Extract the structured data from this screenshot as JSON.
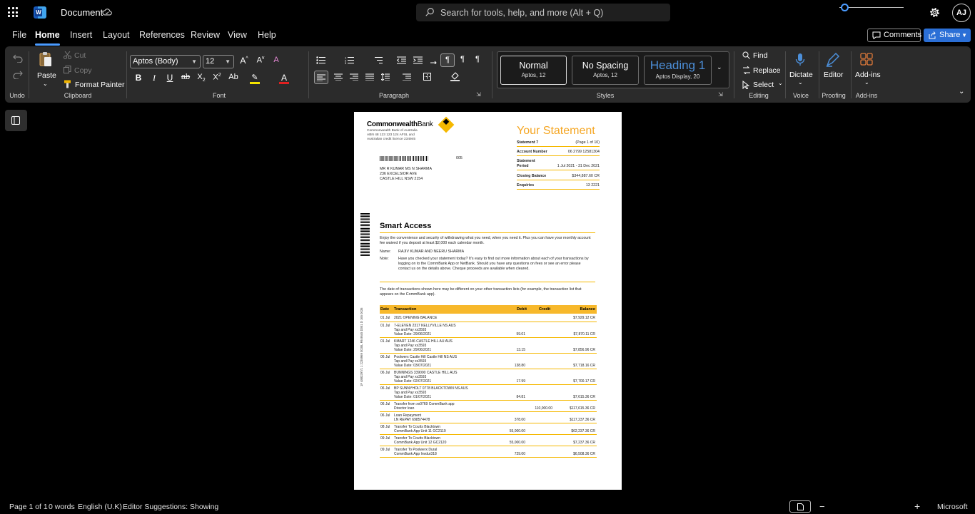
{
  "titlebar": {
    "app_icon": "word-icon",
    "app_letter": "W",
    "document_title": "Document",
    "search_placeholder": "Search for tools, help, and more (Alt + Q)",
    "avatar_initials": "AJ"
  },
  "menu": {
    "tabs": [
      "File",
      "Home",
      "Insert",
      "Layout",
      "References",
      "Review",
      "View",
      "Help"
    ],
    "active_tab": "Home",
    "comments_label": "Comments",
    "share_label": "Share"
  },
  "ribbon": {
    "undo": {
      "group_label": "Undo"
    },
    "clipboard": {
      "group_label": "Clipboard",
      "paste": "Paste",
      "cut": "Cut",
      "copy": "Copy",
      "format_painter": "Format Painter"
    },
    "font": {
      "group_label": "Font",
      "font_name": "Aptos (Body)",
      "font_size": "12"
    },
    "paragraph": {
      "group_label": "Paragraph"
    },
    "styles": {
      "group_label": "Styles",
      "items": [
        {
          "name": "Normal",
          "sub": "Aptos, 12"
        },
        {
          "name": "No Spacing",
          "sub": "Aptos, 12"
        },
        {
          "name": "Heading 1",
          "sub": "Aptos Display, 20"
        }
      ]
    },
    "editing": {
      "group_label": "Editing",
      "find": "Find",
      "replace": "Replace",
      "select": "Select"
    },
    "voice": {
      "group_label": "Voice",
      "dictate": "Dictate"
    },
    "proofing": {
      "group_label": "Proofing",
      "editor": "Editor"
    },
    "addins": {
      "group_label": "Add-ins",
      "addins": "Add-ins"
    }
  },
  "document": {
    "bank_name_bold": "Commonwealth",
    "bank_name_rest": "Bank",
    "bank_info": [
      "Commonwealth Bank of Australia",
      "ABN 48 123 123 124  AFSL and",
      "Australian credit licence 234945"
    ],
    "mail_code": "005",
    "address": [
      "MR R KUMAR MS N SHARMA",
      "236 EXCELSIOR AVE",
      "CASTLE HILL NSW 2154"
    ],
    "statement_heading": "Your Statement",
    "summary": [
      {
        "k": "Statement 7",
        "v": "(Page 1 of 10)"
      },
      {
        "k": "Account Number",
        "v": "06 2799 12581304"
      },
      {
        "k": "Statement Period",
        "v": "1 Jul 2021 - 31 Dec 2021"
      },
      {
        "k": "Closing Balance",
        "v": "$344,887.60 CR"
      },
      {
        "k": "Enquiries",
        "v": "13 2221"
      }
    ],
    "vertical_code": "1F 4883297/1 1 2235969 0035L R6 8645 D051 D 165 0035",
    "section_title": "Smart Access",
    "intro": "Enjoy the convenience and security of withdrawing what you need, when you need it. Plus you can have your monthly account fee waived if you deposit at least $2,000 each calendar month.",
    "name_label": "Name:",
    "name_value": "RAJIV KUMAR AND NEERU SHARMA",
    "note_label": "Note:",
    "note_value": "Have you checked your statement today? It's easy to find out more information about each of your transactions by logging on to the CommBank App or NetBank. Should you have any questions on fees or see an error please contact us on the details above. Cheque proceeds are available when cleared.",
    "date_note": "The date of transactions shown here may be different on your other transaction lists (for example, the transaction list that appears on the CommBank app).",
    "table_headers": [
      "Date",
      "Transaction",
      "Debit",
      "Credit",
      "Balance"
    ],
    "transactions": [
      {
        "date": "01 Jul",
        "lines": [
          "2021 OPENING BALANCE"
        ],
        "debit": "",
        "credit": "",
        "balance": "$7,929.12 CR"
      },
      {
        "date": "01 Jul",
        "lines": [
          "7-ELEVEN 2317 KELLYVILLE NS AUS",
          "Tap and Pay xx3593",
          "Value Date: 29/06/2021"
        ],
        "debit": "59.01",
        "credit": "",
        "balance": "$7,870.11 CR"
      },
      {
        "date": "01 Jul",
        "lines": [
          "KMART 1246 CASTLE HILL AU AUS",
          "Tap and Pay xx3593",
          "Value Date: 29/06/2021"
        ],
        "debit": "13.15",
        "credit": "",
        "balance": "$7,856.96 CR"
      },
      {
        "date": "06 Jul",
        "lines": [
          "Poolwerx Castle Hill Castle Hill NS AUS",
          "Tap and Pay xx3593",
          "Value Date: 03/07/2021"
        ],
        "debit": "138.80",
        "credit": "",
        "balance": "$7,718.16 CR"
      },
      {
        "date": "06 Jul",
        "lines": [
          "BUNNINGS 339000 CASTLE HILL AUS",
          "Tap and Pay xx3593",
          "Value Date: 02/07/2021"
        ],
        "debit": "17.99",
        "credit": "",
        "balance": "$7,700.17 CR"
      },
      {
        "date": "06 Jul",
        "lines": [
          "BP SUNNYHOLT 0778 BLACKTOWN NS AUS",
          "Tap and Pay xx3593",
          "Value Date: 01/07/2021"
        ],
        "debit": "84.81",
        "credit": "",
        "balance": "$7,615.36 CR"
      },
      {
        "date": "06 Jul",
        "lines": [
          "Transfer from xx0769 CommBank app",
          "Director loan"
        ],
        "debit": "",
        "credit": "110,000.00",
        "balance": "$117,615.36 CR"
      },
      {
        "date": "06 Jul",
        "lines": [
          "Loan Repayment",
          "LN REPAY 698574478"
        ],
        "debit": "378.00",
        "credit": "",
        "balance": "$117,237.36 CR"
      },
      {
        "date": "08 Jul",
        "lines": [
          "Transfer To Coutts Blacktown",
          "CommBank App Unit 11 GC2119"
        ],
        "debit": "55,000.00",
        "credit": "",
        "balance": "$62,237.36 CR"
      },
      {
        "date": "09 Jul",
        "lines": [
          "Transfer To Coutts Blacktown",
          "CommBank App Unit 12 GC2120"
        ],
        "debit": "55,000.00",
        "credit": "",
        "balance": "$7,237.36 CR"
      },
      {
        "date": "09 Jul",
        "lines": [
          "Transfer To Poolwerx Dural",
          "CommBank App Invdur318"
        ],
        "debit": "729.00",
        "credit": "",
        "balance": "$6,508.36 CR"
      }
    ]
  },
  "statusbar": {
    "page": "Page 1 of 1",
    "words": "0 words",
    "language": "English (U.K)",
    "editor": "Editor Suggestions: Showing",
    "zoom_minus": "−",
    "zoom_plus": "+",
    "brand": "Microsoft"
  },
  "colors": {
    "accent": "#4a9bff",
    "share": "#2b6fd6",
    "statement_yellow": "#f5b800",
    "heading_blue": "#4c8fd9"
  }
}
